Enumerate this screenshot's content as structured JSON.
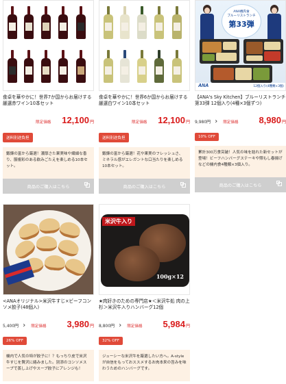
{
  "products": [
    {
      "title": "食卓を華やかに！世界7か国からお届けする厳選赤ワイン10本セット",
      "original_price": "",
      "price_label": "限定価格",
      "price": "12,100",
      "currency": "円",
      "badge": "送料別途負担",
      "description": "鍛錬の富から厳選！濃厚さた果実味や繊細な香り、服複彩のある飲みごたえを楽しめる10本セット。",
      "buy_label": "商品のご購入はこちら",
      "image": "red-wine-bottles"
    },
    {
      "title": "食卓を華やかに！世界6か国からお届けする厳選白ワイン10本セット",
      "original_price": "",
      "price_label": "限定価格",
      "price": "12,100",
      "currency": "円",
      "badge": "送料別途負担",
      "description": "鍛錬の富から厳選！花や果実のフレッシュさ、ミネラル感がエレガントな口当たりを楽しめる10本セット。",
      "buy_label": "商品のご購入はこちら",
      "image": "white-wine-bottles"
    },
    {
      "title": "【ANA's Sky Kitchen】ブルーリストランチ第33弾 12個入り(4種×3個ずつ)",
      "original_price": "9,980円",
      "price_label": "限定価格",
      "price": "8,980",
      "currency": "円",
      "badge": "10% OFF",
      "description": "累計300万食突破！人気の味を詰れた新セットが登場！ビーフハンバーグステーキや照もし春揚げなどの機内食4種類×3個入り。",
      "buy_label": "商品のご購入はこちら",
      "image": "ana-in-flight-meal",
      "image_text": {
        "line1": "ANA機内食",
        "line2": "ブルーリストランチ",
        "line3": "第33弾",
        "logo": "ANA",
        "caption": "12個入り(4種類×3個)"
      }
    },
    {
      "title": "<ANAオリジナル>米沢牛すじ×ビーフコンソメ餃子(48個入)",
      "original_price": "5,400円",
      "price_label": "限定価格",
      "price": "3,980",
      "currency": "円",
      "badge": "26% OFF",
      "description": "機内で人気の特が餃子に！？もっちり皮で米沢牛すじを贅沢に絡みました。別添のコンソメスープで蒸し上げやスープ餃子にアレンジも！",
      "image": "gyoza-plate"
    },
    {
      "title": "★肉好きのための専門店★＜米沢牛処 肉の上杉＞米沢牛入りハンバーグ12個",
      "original_price": "8,800円",
      "price_label": "限定価格",
      "price": "5,984",
      "currency": "円",
      "badge": "32% OFF",
      "description": "ジューシーな米沢牛を厳選したい方へ。A-styleが自信をもっておススメするお肉本来の旨みを味わうためのハンバーグです。",
      "image": "hamburg-steak",
      "image_text": {
        "ribbon": "米沢牛入り",
        "weight": "100g×12"
      }
    }
  ],
  "colors": {
    "price_red": "#d91b1b",
    "badge_red": "#e04a39",
    "desc_bg": "#fdf1e4",
    "buy_gray": "#cfcfcf"
  }
}
